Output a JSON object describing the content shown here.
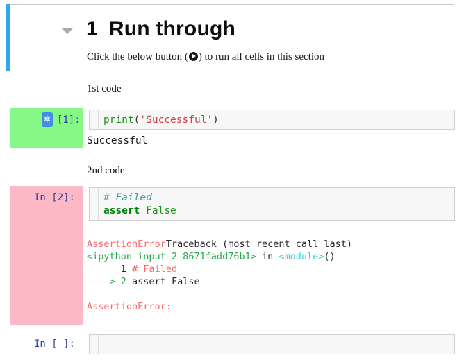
{
  "section": {
    "caret_icon": "chevron-down-icon",
    "number": "1",
    "title": "Run through",
    "subtitle_before": "Click the below button (",
    "subtitle_after": ") to run all cells in this section",
    "play_icon": "play-circle-icon",
    "accent_color": "#30a8f0"
  },
  "labels": {
    "first": "1st code",
    "second": "2nd code"
  },
  "cells": [
    {
      "prompt": "[1]:",
      "badge_icon": "snowflake-icon",
      "badge_glyph": "❅",
      "prompt_bg_color": "#86f886",
      "code": {
        "fn": "print",
        "open": "(",
        "string": "'Successful'",
        "close": ")"
      },
      "output": "Successful"
    },
    {
      "prompt": "In [2]:",
      "prompt_bg_color": "#fcb8c4",
      "code": {
        "comment": "# Failed",
        "keyword": "assert",
        "constant": "False"
      },
      "traceback": {
        "line1_error": "AssertionError",
        "line1_rest": "Traceback (most recent call last)",
        "line2_file": "<ipython-input-2-8671fadd76b1>",
        "line2_in": " in ",
        "line2_module": "<module>",
        "line2_parens": "()",
        "line3_num": "1",
        "line3_code": "# Failed",
        "line4_arrow": "----> ",
        "line4_num": "2",
        "line4_code": " assert False",
        "line5": "AssertionError:"
      }
    },
    {
      "prompt": "In [ ]:",
      "code": ""
    }
  ]
}
